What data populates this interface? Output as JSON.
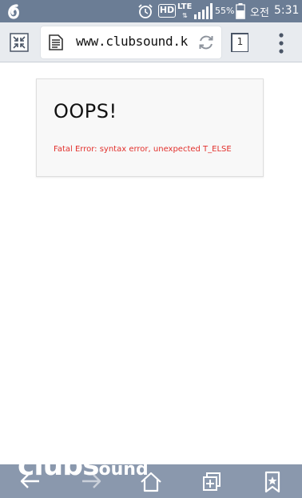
{
  "status_bar": {
    "ampm": "오전",
    "time": "5:31",
    "battery_percent": "55%",
    "network": "LTE",
    "hd_badge": "HD",
    "icons": [
      "carrier-logo-icon",
      "alarm-icon",
      "hd-voice-icon",
      "lte-icon",
      "signal-icon",
      "battery-icon"
    ]
  },
  "browser": {
    "url": "www.clubsound.k·",
    "tab_count": "1",
    "icons": [
      "fullscreen-exit-icon",
      "page-icon",
      "reload-icon",
      "tabs-icon",
      "overflow-menu-icon"
    ]
  },
  "error": {
    "title": "OOPS!",
    "message": "Fatal Error: syntax error, unexpected T_ELSE",
    "message_color": "#e2312d"
  },
  "watermark": {
    "text_big": "clubs",
    "text_small": "ound"
  },
  "bottom_nav": {
    "icons": [
      "back-arrow-icon",
      "forward-arrow-icon",
      "home-icon",
      "windows-icon",
      "bookmark-icon"
    ]
  },
  "colors": {
    "status_bar": "#6b7d95",
    "address_bar": "#e8ebef",
    "bottom_bar": "#8a98ad"
  }
}
